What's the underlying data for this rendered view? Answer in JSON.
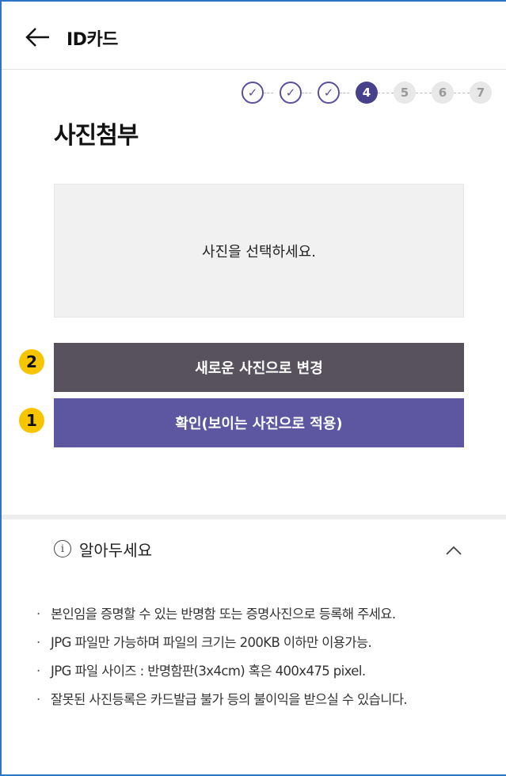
{
  "header": {
    "title": "ID카드"
  },
  "steps": [
    {
      "label": "✓",
      "state": "done"
    },
    {
      "label": "✓",
      "state": "done"
    },
    {
      "label": "✓",
      "state": "done"
    },
    {
      "label": "4",
      "state": "current"
    },
    {
      "label": "5",
      "state": "todo"
    },
    {
      "label": "6",
      "state": "todo"
    },
    {
      "label": "7",
      "state": "todo"
    }
  ],
  "section": {
    "title": "사진첨부"
  },
  "photo": {
    "placeholder": "사진을 선택하세요."
  },
  "buttons": {
    "change_label": "새로운 사진으로 변경",
    "confirm_label": "확인(보이는 사진으로 적용)"
  },
  "badges": {
    "change": "2",
    "confirm": "1"
  },
  "notice": {
    "title": "알아두세요",
    "items": [
      "본인임을 증명할 수 있는 반명함 또는 증명사진으로 등록해 주세요.",
      "JPG 파일만 가능하며 파일의 크기는 200KB 이하만 이용가능.",
      "JPG 파일 사이즈 : 반명함판(3x4cm) 혹은 400x475 pixel.",
      "잘못된 사진등록은 카드발급 불가 등의 불이익을 받으실 수 있습니다."
    ]
  },
  "colors": {
    "accent": "#5c57a0",
    "step_current": "#47408a",
    "change_button": "#58525e",
    "badge": "#f7c500",
    "frame_border": "#2f74c9"
  },
  "icons": {
    "back": "arrow-left-icon",
    "info": "info-icon",
    "collapse": "chevron-up-icon"
  }
}
